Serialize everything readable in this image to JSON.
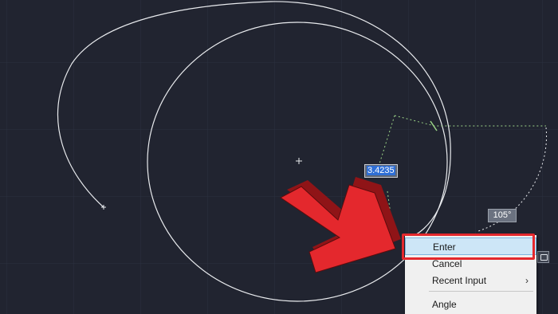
{
  "dynamic_input": {
    "value": "3.4235"
  },
  "angle_tooltip": {
    "value": "105°"
  },
  "context_menu": {
    "items": [
      {
        "label": "Enter"
      },
      {
        "label": "Cancel"
      },
      {
        "label": "Recent Input",
        "chevron": "›"
      },
      {
        "label": "Angle"
      }
    ]
  },
  "colors": {
    "canvas_background": "#212430",
    "grid": "#2c3140",
    "geometry": "#e9ebee",
    "green_dotted": "#9bd487",
    "annotation_arrow": "#e4282d",
    "highlight_box": "#e4282d",
    "menu_hover": "#cde6f7"
  },
  "icons": {
    "cursor_crosshair": "crosshair-icon",
    "annotation_arrow": "red-arrow-icon",
    "side_tool": "monitor-icon"
  }
}
